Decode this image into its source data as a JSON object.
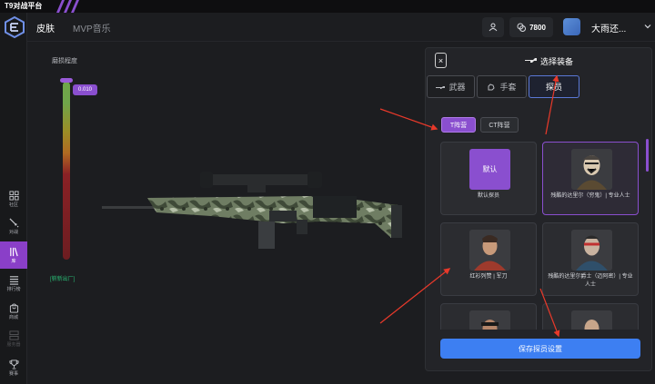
{
  "app": {
    "title": "T9对战平台"
  },
  "sidebar": {
    "items": [
      {
        "label": "社区",
        "icon": "grid-icon"
      },
      {
        "label": "对战",
        "icon": "swords-icon"
      },
      {
        "label": "库",
        "icon": "library-icon",
        "active": true
      },
      {
        "label": "排行榜",
        "icon": "leaderboard-icon"
      },
      {
        "label": "商城",
        "icon": "shop-icon"
      },
      {
        "label": "服务器",
        "icon": "server-icon",
        "dim": true
      },
      {
        "label": "赛事",
        "icon": "trophy-icon"
      }
    ]
  },
  "header": {
    "tabs": [
      {
        "label": "皮肤"
      },
      {
        "label": "MVP音乐"
      }
    ],
    "coins": "7800",
    "username": "大雨还..."
  },
  "wear": {
    "label": "磨损程度",
    "value": "0.010",
    "level": 0.01,
    "note": "[崭新出厂]"
  },
  "panel": {
    "close": "×",
    "title": "选择装备",
    "tabs": [
      {
        "label": "武器"
      },
      {
        "label": "手套"
      },
      {
        "label": "探员"
      }
    ],
    "teams": [
      {
        "label": "T阵营"
      },
      {
        "label": "CT阵营"
      }
    ],
    "cards": [
      {
        "name": "默认探员",
        "default_label": "默认"
      },
      {
        "name": "残酷的达里尔（穷鬼）| 专业人士",
        "selected": true
      },
      {
        "name": "红衫列赞 | 军刀"
      },
      {
        "name": "残酷的达里尔爵士（迈阿密）| 专业人士"
      },
      {
        "name": ""
      },
      {
        "name": ""
      }
    ],
    "save_label": "保存探员设置"
  },
  "colors": {
    "accent": "#8a4fcf",
    "primary_button": "#3d7ff2",
    "annotation": "#e8392a"
  }
}
